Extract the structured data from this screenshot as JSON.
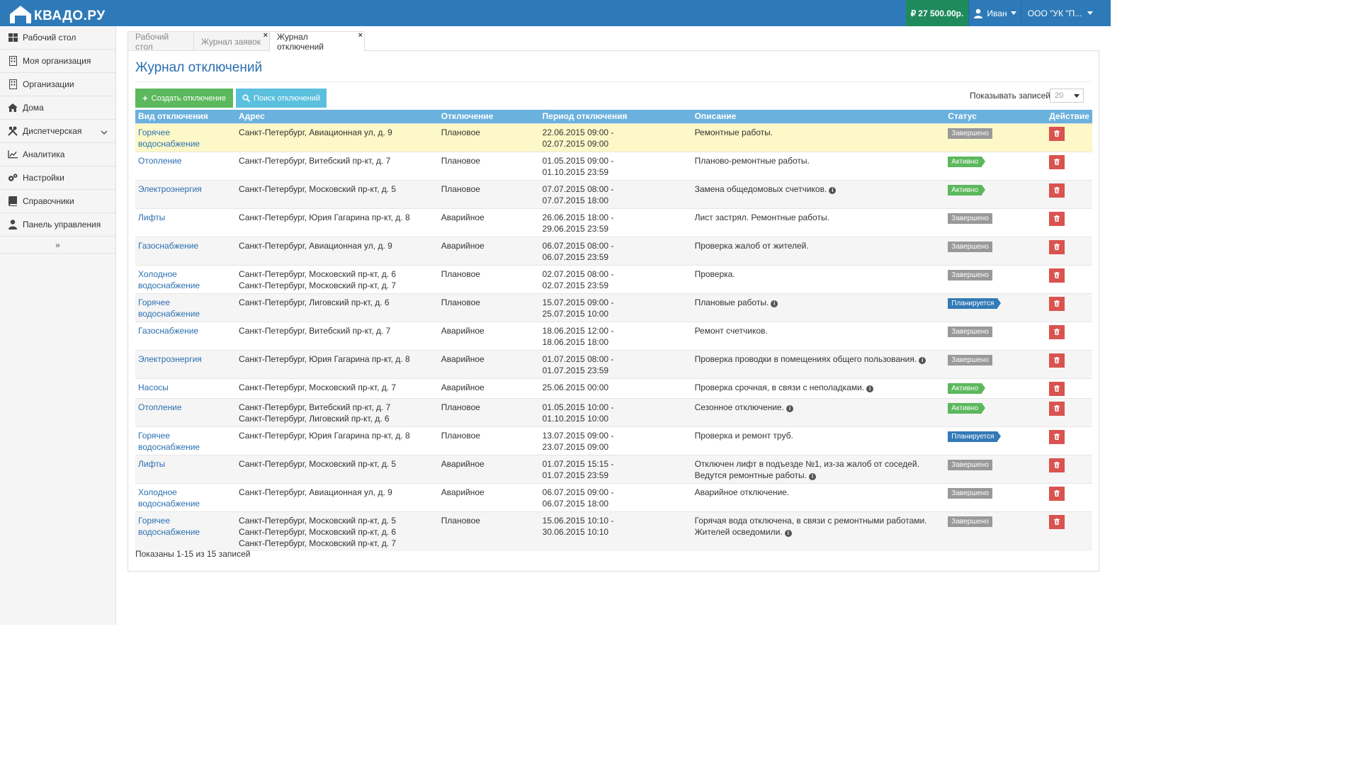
{
  "app": {
    "logo_text": "КВАДО.РУ"
  },
  "header": {
    "balance": "27 500.00р.",
    "user_name": "Иван",
    "org_name": "ООО \"УК \"П..."
  },
  "sidebar": {
    "items": [
      {
        "label": "Рабочий стол",
        "icon": "grid-icon"
      },
      {
        "label": "Моя организация",
        "icon": "building-icon"
      },
      {
        "label": "Организации",
        "icon": "building-icon"
      },
      {
        "label": "Дома",
        "icon": "home-icon"
      },
      {
        "label": "Диспетчерская",
        "icon": "tools-icon"
      },
      {
        "label": "Аналитика",
        "icon": "chart-line-icon"
      },
      {
        "label": "Настройки",
        "icon": "gears-icon"
      },
      {
        "label": "Справочники",
        "icon": "book-icon"
      },
      {
        "label": "Панель управления",
        "icon": "user-icon"
      }
    ],
    "collapse_label": "»"
  },
  "tabs": [
    {
      "label": "Рабочий стол"
    },
    {
      "label": "Журнал заявок",
      "close": "×"
    },
    {
      "label": "Журнал отключений",
      "close": "×"
    }
  ],
  "page": {
    "title": "Журнал отключений",
    "create_button": "Создать отключение",
    "search_button": "Поиск отключений",
    "per_page_label": "Показывать записей",
    "per_page_value": "20",
    "footer": "Показаны 1-15 из 15 записей"
  },
  "table": {
    "headers": [
      "Вид отключения",
      "Адрес",
      "Отключение",
      "Период отключения",
      "Описание",
      "Статус",
      "Действие"
    ],
    "rows": [
      {
        "type": "Горячее водоснабжение",
        "address": [
          "Санкт-Петербург, Авиационная ул, д. 9"
        ],
        "kind": "Плановое",
        "period": [
          "22.06.2015 09:00 -",
          "02.07.2015 09:00"
        ],
        "description": [
          "Ремонтные работы."
        ],
        "info": false,
        "status": "Завершено",
        "status_color": "grey"
      },
      {
        "type": "Отопление",
        "address": [
          "Санкт-Петербург, Витебский пр-кт, д. 7"
        ],
        "kind": "Плановое",
        "period": [
          "01.05.2015 09:00 -",
          "01.10.2015 23:59"
        ],
        "description": [
          "Планово-ремонтные работы."
        ],
        "info": false,
        "status": "Активно",
        "status_color": "green"
      },
      {
        "type": "Электроэнергия",
        "address": [
          "Санкт-Петербург, Московский пр-кт, д. 5"
        ],
        "kind": "Плановое",
        "period": [
          "07.07.2015 08:00 -",
          "07.07.2015 18:00"
        ],
        "description": [
          "Замена общедомовых счетчиков."
        ],
        "info": true,
        "status": "Активно",
        "status_color": "green"
      },
      {
        "type": "Лифты",
        "address": [
          "Санкт-Петербург, Юрия Гагарина пр-кт, д. 8"
        ],
        "kind": "Аварийное",
        "period": [
          "26.06.2015 18:00 -",
          "29.06.2015 23:59"
        ],
        "description": [
          "Лист застрял. Ремонтные работы."
        ],
        "info": false,
        "status": "Завершено",
        "status_color": "grey"
      },
      {
        "type": "Газоснабжение",
        "address": [
          "Санкт-Петербург, Авиационная ул, д. 9"
        ],
        "kind": "Аварийное",
        "period": [
          "06.07.2015 08:00 -",
          "06.07.2015 23:59"
        ],
        "description": [
          "Проверка жалоб от жителей."
        ],
        "info": false,
        "status": "Завершено",
        "status_color": "grey"
      },
      {
        "type": "Холодное водоснабжение",
        "address": [
          "Санкт-Петербург, Московский пр-кт, д. 6",
          "Санкт-Петербург, Московский пр-кт, д. 7"
        ],
        "kind": "Плановое",
        "period": [
          "02.07.2015 08:00 -",
          "02.07.2015 23:59"
        ],
        "description": [
          "Проверка."
        ],
        "info": false,
        "status": "Завершено",
        "status_color": "grey"
      },
      {
        "type": "Горячее водоснабжение",
        "address": [
          "Санкт-Петербург, Лиговский пр-кт, д. 6"
        ],
        "kind": "Плановое",
        "period": [
          "15.07.2015 09:00 -",
          "25.07.2015 10:00"
        ],
        "description": [
          "Плановые работы."
        ],
        "info": true,
        "status": "Планируется",
        "status_color": "blue"
      },
      {
        "type": "Газоснабжение",
        "address": [
          "Санкт-Петербург, Витебский пр-кт, д. 7"
        ],
        "kind": "Аварийное",
        "period": [
          "18.06.2015 12:00 -",
          "18.06.2015 18:00"
        ],
        "description": [
          "Ремонт счетчиков."
        ],
        "info": false,
        "status": "Завершено",
        "status_color": "grey"
      },
      {
        "type": "Электроэнергия",
        "address": [
          "Санкт-Петербург, Юрия Гагарина пр-кт, д. 8"
        ],
        "kind": "Аварийное",
        "period": [
          "01.07.2015 08:00 -",
          "01.07.2015 23:59"
        ],
        "description": [
          "Проверка проводки в помещениях общего пользования."
        ],
        "info": true,
        "status": "Завершено",
        "status_color": "grey"
      },
      {
        "type": "Насосы",
        "address": [
          "Санкт-Петербург, Московский пр-кт, д. 7"
        ],
        "kind": "Аварийное",
        "period": [
          "25.06.2015 00:00"
        ],
        "description": [
          "Проверка срочная, в связи с неполадками."
        ],
        "info": true,
        "status": "Активно",
        "status_color": "green"
      },
      {
        "type": "Отопление",
        "address": [
          "Санкт-Петербург, Витебский пр-кт, д. 7",
          "Санкт-Петербург, Лиговский пр-кт, д. 6"
        ],
        "kind": "Плановое",
        "period": [
          "01.05.2015 10:00 -",
          "01.10.2015 10:00"
        ],
        "description": [
          "Сезонное отключение."
        ],
        "info": true,
        "status": "Активно",
        "status_color": "green"
      },
      {
        "type": "Горячее водоснабжение",
        "address": [
          "Санкт-Петербург, Юрия Гагарина пр-кт, д. 8"
        ],
        "kind": "Плановое",
        "period": [
          "13.07.2015 09:00 -",
          "23.07.2015 09:00"
        ],
        "description": [
          "Проверка и ремонт труб."
        ],
        "info": false,
        "status": "Планируется",
        "status_color": "blue"
      },
      {
        "type": "Лифты",
        "address": [
          "Санкт-Петербург, Московский пр-кт, д. 5"
        ],
        "kind": "Аварийное",
        "period": [
          "01.07.2015 15:15 -",
          "01.07.2015 23:59"
        ],
        "description": [
          "Отключен лифт в подъезде №1, из-за жалоб от соседей.",
          "Ведутся ремонтные работы."
        ],
        "info": true,
        "status": "Завершено",
        "status_color": "grey"
      },
      {
        "type": "Холодное водоснабжение",
        "address": [
          "Санкт-Петербург, Авиационная ул, д. 9"
        ],
        "kind": "Аварийное",
        "period": [
          "06.07.2015 09:00 -",
          "06.07.2015 18:00"
        ],
        "description": [
          "Аварийное отключение."
        ],
        "info": false,
        "status": "Завершено",
        "status_color": "grey"
      },
      {
        "type": "Горячее водоснабжение",
        "address": [
          "Санкт-Петербург, Московский пр-кт, д. 5",
          "Санкт-Петербург, Московский пр-кт, д. 6",
          "Санкт-Петербург, Московский пр-кт, д. 7"
        ],
        "kind": "Плановое",
        "period": [
          "15.06.2015 10:10 -",
          "30.06.2015 10:10"
        ],
        "description": [
          "Горячая вода отключена, в связи с ремонтными работами.",
          "Жителей осведомили."
        ],
        "info": true,
        "status": "Завершено",
        "status_color": "grey"
      }
    ]
  }
}
